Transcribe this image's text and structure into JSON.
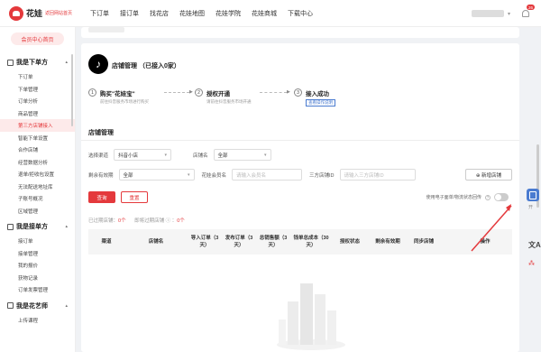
{
  "header": {
    "logo_text": "花娃",
    "logo_sub": "返回网站首页",
    "nav": [
      "下订单",
      "接订单",
      "找花店",
      "花娃地图",
      "花娃学院",
      "花娃商城",
      "下载中心"
    ],
    "notification_count": "26"
  },
  "sidebar": {
    "member_center": "会员中心首页",
    "groups": [
      {
        "title": "我是下单方",
        "items": [
          "下订单",
          "下单管理",
          "订单分析",
          "商品管理",
          "第三方店铺接入",
          "智能下单设置",
          "合作店铺",
          "经营数据分析",
          "退单/拒收包设置",
          "无法配送地址库",
          "子账号概况",
          "区域管理"
        ]
      },
      {
        "title": "我是接单方",
        "items": [
          "接订单",
          "接单管理",
          "我的报价",
          "获物记录",
          "订单发票管理"
        ]
      },
      {
        "title": "我是花艺师",
        "items": [
          "上传课程"
        ]
      }
    ],
    "active_item": "第三方店铺接入"
  },
  "shop_card": {
    "logo_glyph": "♪",
    "title": "店铺管理  （已接入0家）",
    "steps": [
      {
        "num": "1",
        "title": "购买\"花娃宝\"",
        "sub": "前往抖音服务市场进行购买",
        "sub_link": "抖音服务市场"
      },
      {
        "num": "2",
        "title": "授权开通",
        "sub": "请前往抖音服务市场开通"
      },
      {
        "num": "3",
        "title": "接入成功",
        "sub": "",
        "guide": "查看操作说明"
      }
    ]
  },
  "management": {
    "title": "店铺管理",
    "filters": {
      "channel_label": "选择渠道",
      "channel_value": "抖音小店",
      "shop_label": "店铺名",
      "shop_value": "全部",
      "validity_label": "剩余有效期",
      "validity_value": "全部",
      "member_label": "花娃会员名",
      "member_placeholder": "请输入会员名",
      "third_id_label": "三方店铺ID",
      "third_id_placeholder": "请输入三方店铺ID"
    },
    "add_shop_button": "⊕ 新增店铺",
    "query_button": "查询",
    "reset_button": "重置",
    "stats": {
      "expired_label": "已过期店铺：",
      "expired_count": "0个",
      "soon_label": "即将过期店铺",
      "soon_count": "0个"
    },
    "toggle_label": "使用电子面单/物流状态回传",
    "columns": [
      "渠道",
      "店铺名",
      "导入订单（3天）",
      "发布订单（3天）",
      "总销售额（3天）",
      "钱单总成本（30天）",
      "授权状态",
      "剩余有效期",
      "同步店铺",
      "操作"
    ]
  },
  "right_float": {
    "label": "开",
    "a_icon": "文A"
  }
}
